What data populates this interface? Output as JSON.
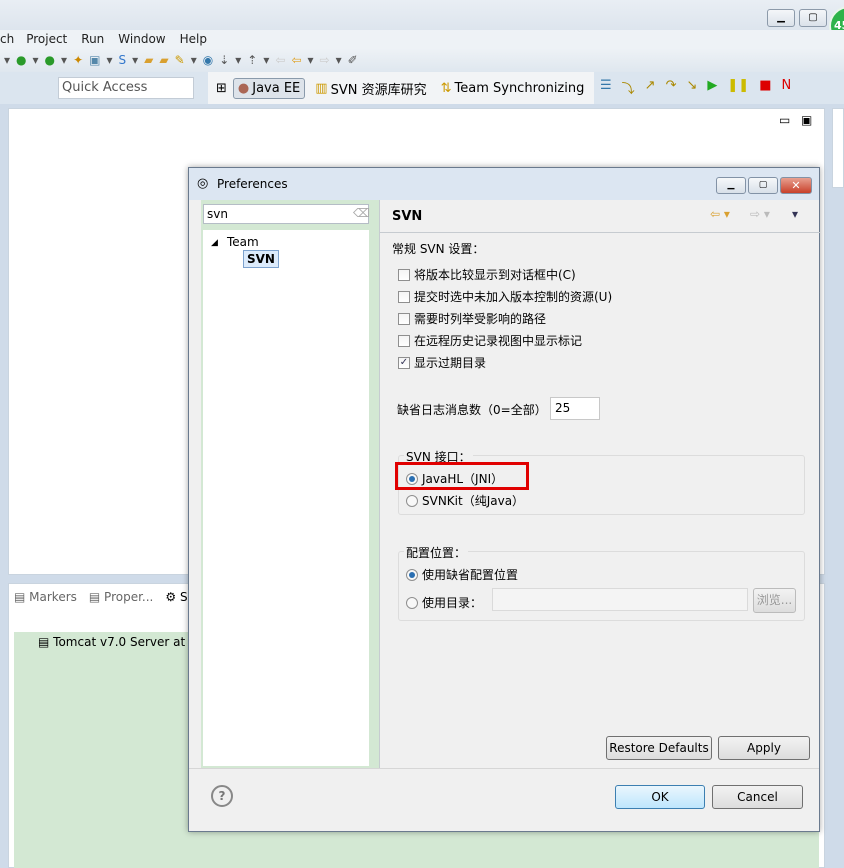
{
  "window": {
    "minimize_icon": "minimize-icon",
    "maximize_icon": "maximize-icon",
    "badge": "45"
  },
  "menu": [
    "ch",
    "Project",
    "Run",
    "Window",
    "Help"
  ],
  "quick_access": {
    "placeholder": "Quick Access"
  },
  "perspectives": [
    {
      "label": "Java EE",
      "active": true
    },
    {
      "label": "SVN 资源库研究"
    },
    {
      "label": "Team Synchronizing"
    }
  ],
  "bottom_tabs": [
    {
      "label": "Markers"
    },
    {
      "label": "Proper..."
    },
    {
      "label": "S"
    }
  ],
  "server_item": "Tomcat v7.0 Server at",
  "dialog": {
    "title": "Preferences",
    "filter": "svn",
    "tree": {
      "parent": "Team",
      "child": "SVN"
    },
    "page_title": "SVN",
    "general_label": "常规 SVN 设置：",
    "checkboxes": [
      {
        "label": "将版本比较显示到对话框中(C)",
        "checked": false
      },
      {
        "label": "提交时选中未加入版本控制的资源(U)",
        "checked": false
      },
      {
        "label": "需要时列举受影响的路径",
        "checked": false
      },
      {
        "label": "在远程历史记录视图中显示标记",
        "checked": false
      },
      {
        "label": "显示过期目录",
        "checked": true
      }
    ],
    "log_label": "缺省日志消息数（0=全部）",
    "log_value": "25",
    "interface_group": "SVN 接口：",
    "interfaces": [
      {
        "label": "JavaHL（JNI）",
        "selected": true
      },
      {
        "label": "SVNKit（纯Java）",
        "selected": false
      }
    ],
    "config_group": "配置位置：",
    "config_options": [
      {
        "label": "使用缺省配置位置",
        "selected": true
      },
      {
        "label": "使用目录：",
        "selected": false
      }
    ],
    "config_dir": "",
    "browse": "浏览...",
    "restore_defaults": "Restore Defaults",
    "apply": "Apply",
    "ok": "OK",
    "cancel": "Cancel",
    "highlight_color": "#e00000"
  }
}
